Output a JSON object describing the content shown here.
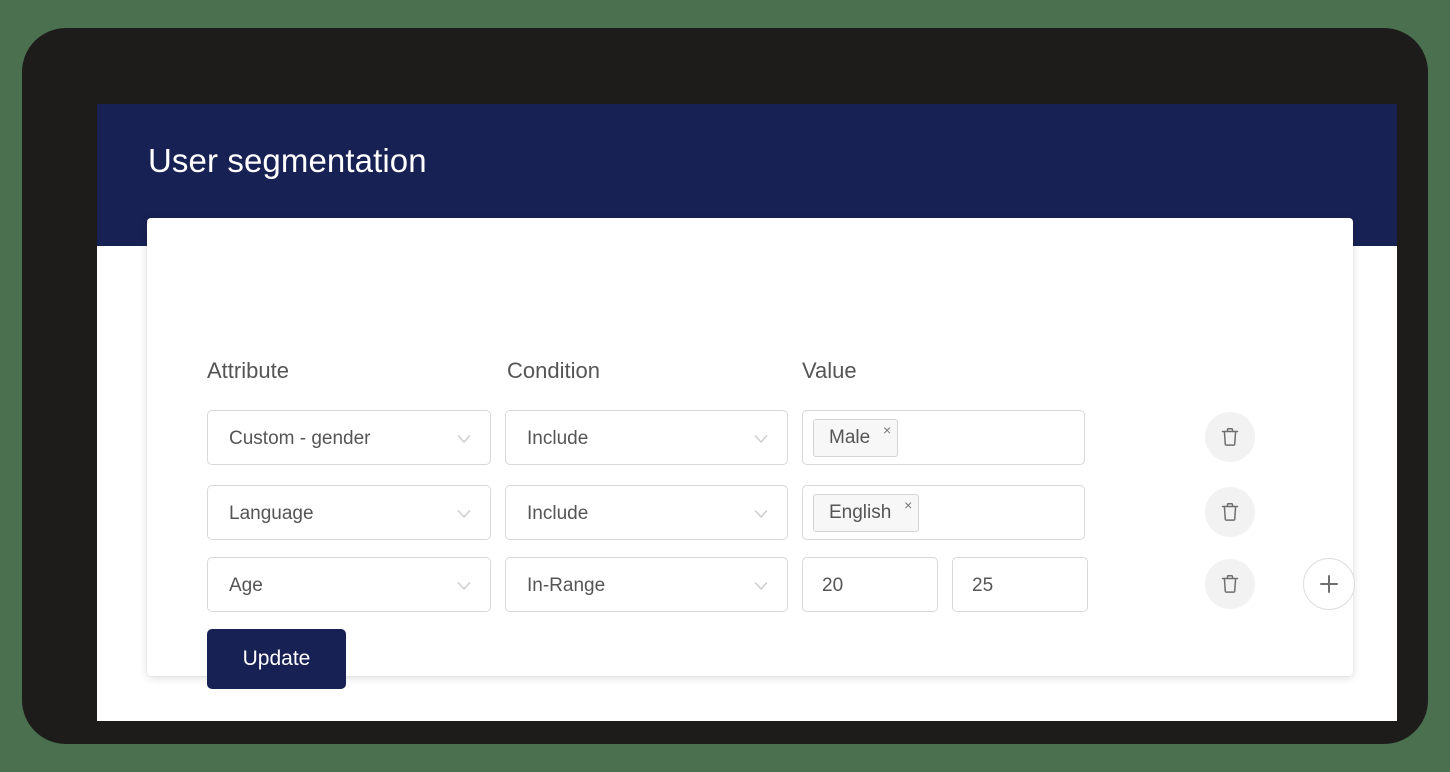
{
  "header": {
    "title": "User segmentation",
    "background_color": "#182154"
  },
  "columns": {
    "attribute_label": "Attribute",
    "condition_label": "Condition",
    "value_label": "Value"
  },
  "rows": [
    {
      "attribute": "Custom - gender",
      "condition": "Include",
      "value_type": "tag",
      "tags": [
        {
          "label": "Male",
          "remove_icon": "×"
        }
      ],
      "delete_icon": "trash-icon"
    },
    {
      "attribute": "Language",
      "condition": "Include",
      "value_type": "tag",
      "tags": [
        {
          "label": "English",
          "remove_icon": "×"
        }
      ],
      "delete_icon": "trash-icon"
    },
    {
      "attribute": "Age",
      "condition": "In-Range",
      "value_type": "range",
      "range_min": "20",
      "range_max": "25",
      "delete_icon": "trash-icon"
    }
  ],
  "actions": {
    "add_row_icon": "plus-icon",
    "update_label": "Update",
    "update_color": "#182154"
  },
  "icons": {
    "chevron": "chevron-down-icon",
    "trash": "trash-icon",
    "plus": "plus-icon"
  },
  "theme": {
    "page_background": "#4a7050",
    "bezel": "#1e1b1b",
    "surface": "#ffffff",
    "field_border": "#d8d8d8",
    "text": "#555555"
  }
}
